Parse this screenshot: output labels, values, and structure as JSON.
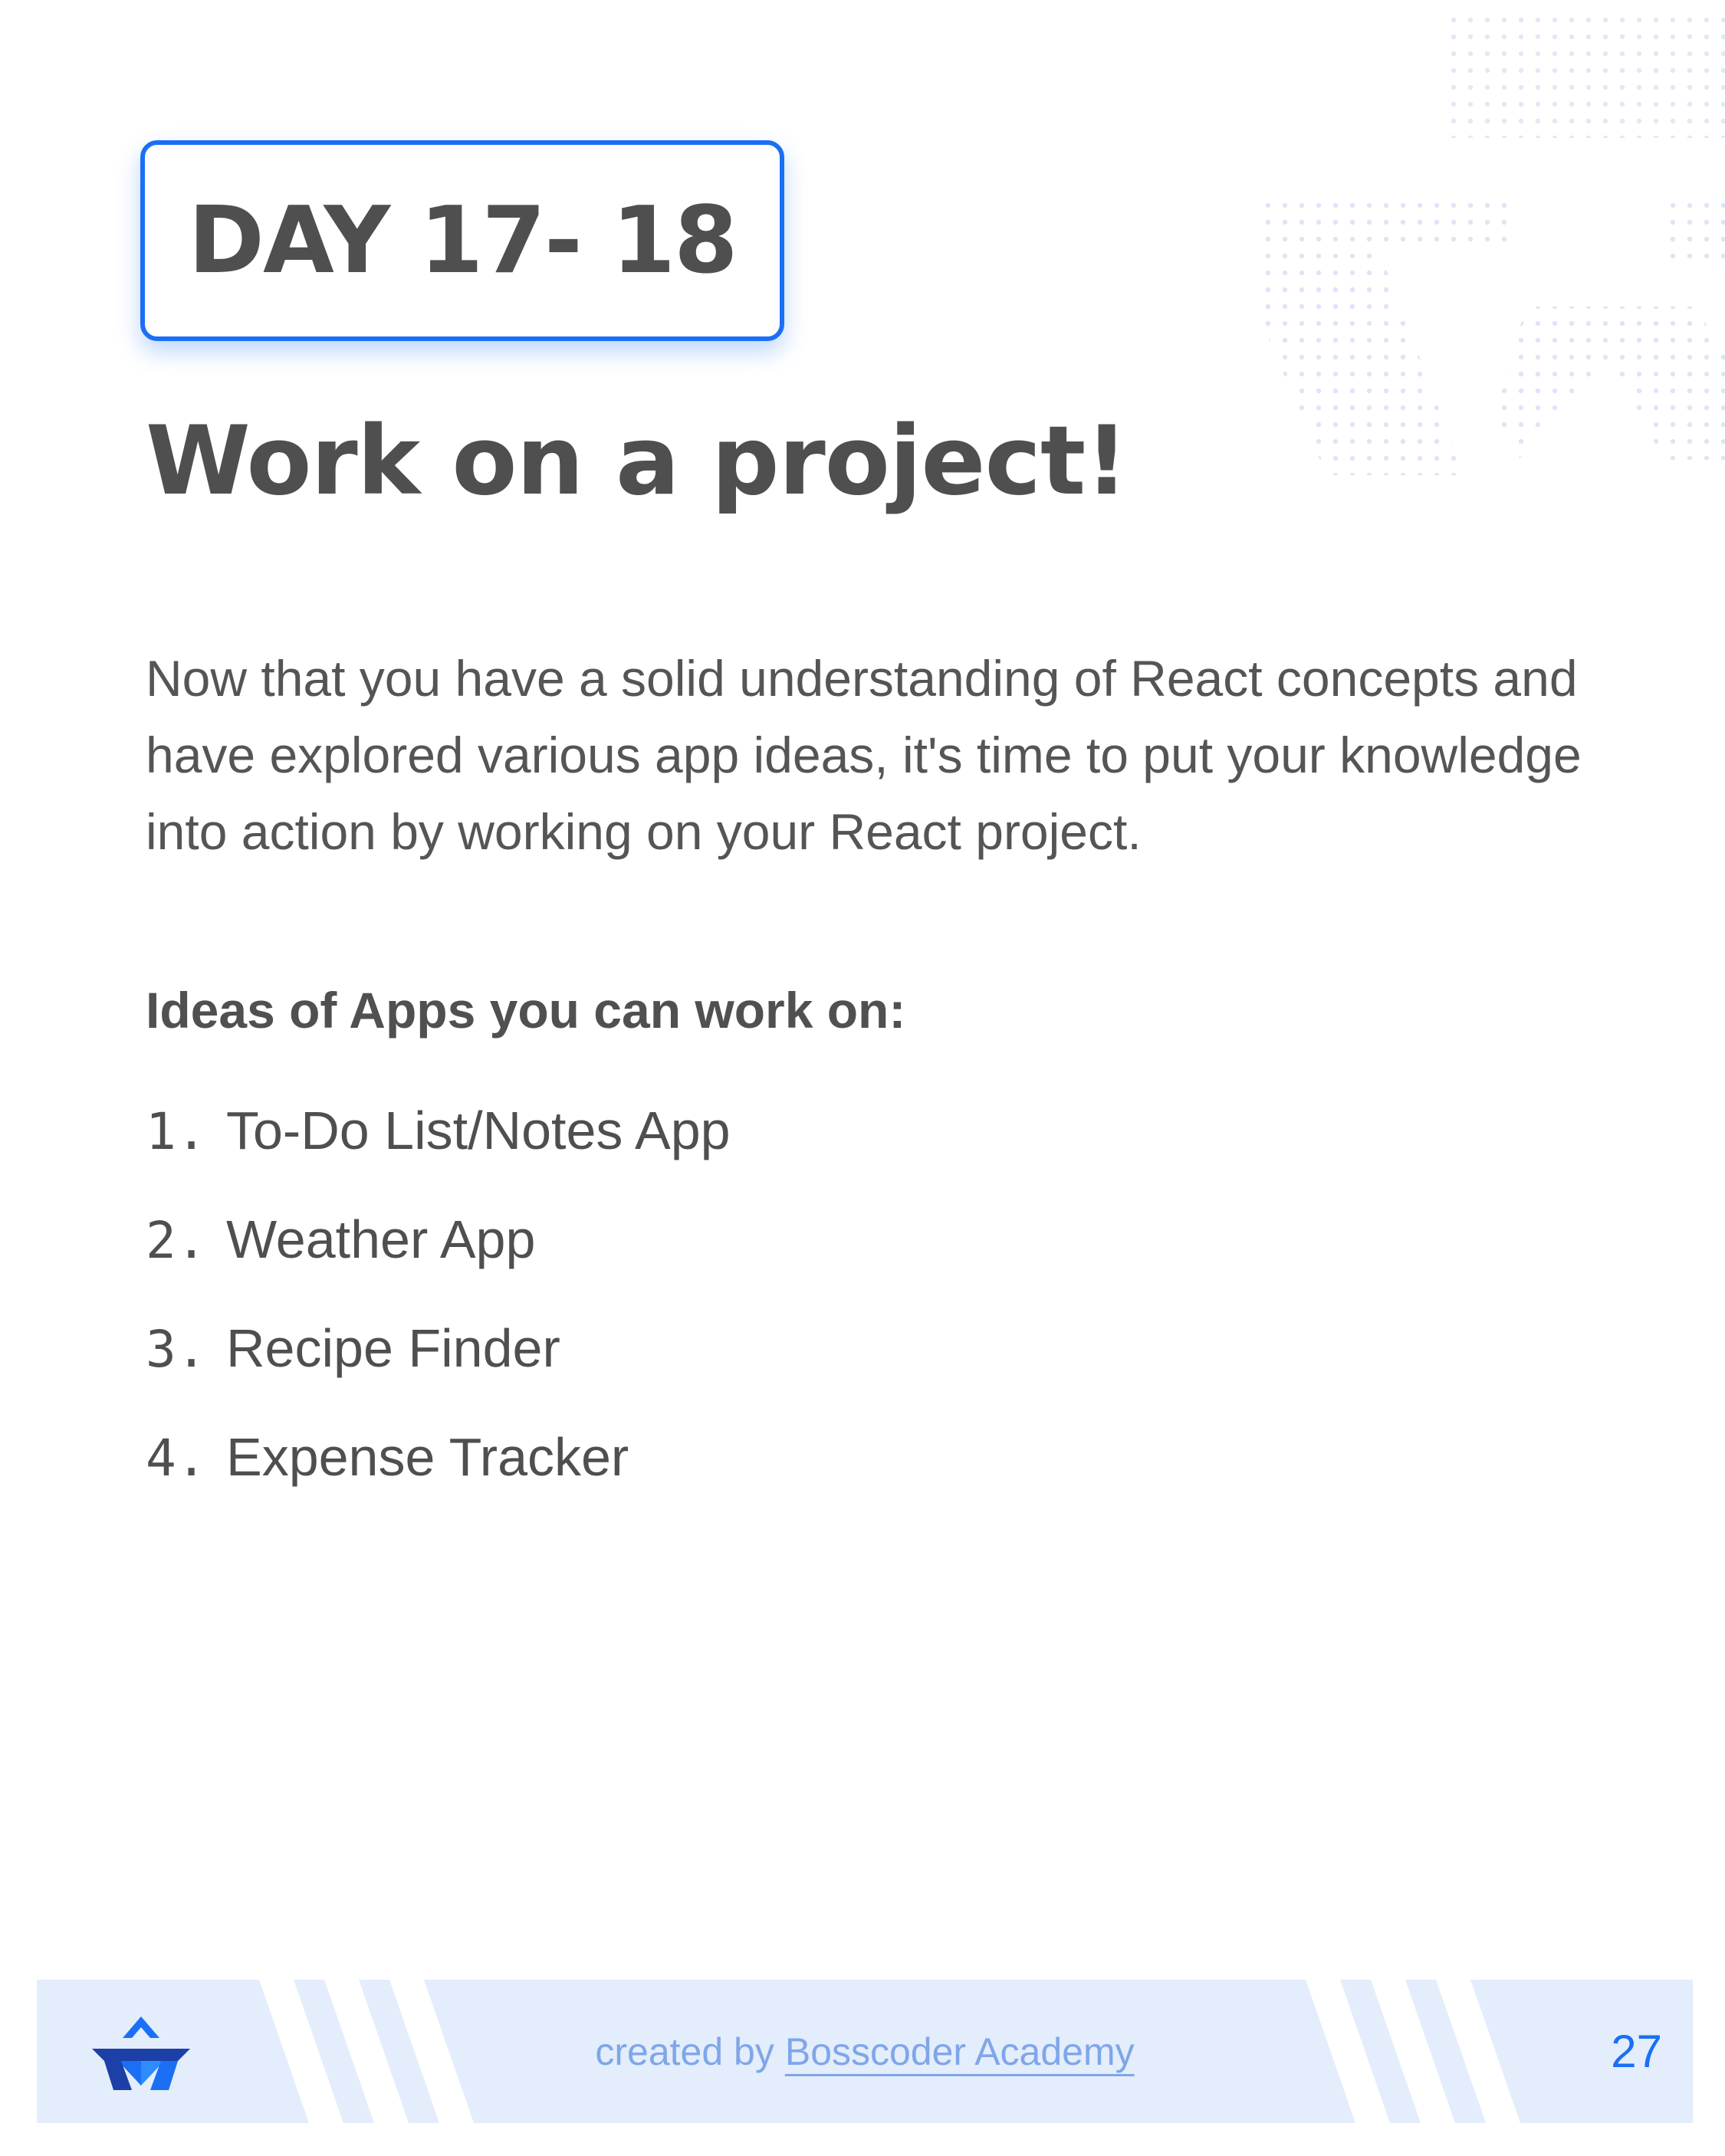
{
  "header": {
    "day_label": "DAY 17- 18",
    "title": "Work on a project!"
  },
  "body": {
    "intro": "Now that you have a solid understanding of React concepts and have explored various app ideas, it's time to put your knowledge into action by working on your React project.",
    "ideas_heading": "Ideas of Apps you can work on:",
    "ideas": [
      {
        "num": "1.",
        "label": "To-Do List/Notes App"
      },
      {
        "num": "2.",
        "label": "Weather App"
      },
      {
        "num": "3.",
        "label": "Recipe Finder"
      },
      {
        "num": "4.",
        "label": "Expense Tracker"
      }
    ]
  },
  "footer": {
    "created_by": "created by",
    "brand": "Bosscoder Academy",
    "page_number": "27",
    "logo_icon": "bosscoder-logo-icon"
  },
  "colors": {
    "accent": "#1a6ff5",
    "text": "#4f4f4f",
    "footer_bg": "#e3edfb",
    "credit_text": "#7fa6e8"
  }
}
